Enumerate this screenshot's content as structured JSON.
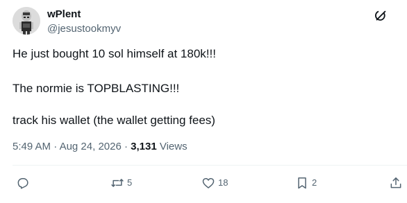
{
  "tweet": {
    "author": {
      "display_name": "wPlent",
      "handle": "@jesustookmyv",
      "avatar_icon": "cartoon-avatar-icon"
    },
    "more_icon": "grok-slash-icon",
    "lines": [
      "He just bought 10 sol himself at 180k!!!",
      "The normie is TOPBLASTING!!!",
      "track his wallet (the wallet getting fees)"
    ],
    "meta": {
      "time": "5:49 AM",
      "separator1": " · ",
      "date": "Aug 24, 2026",
      "separator2": " · ",
      "views_count": "3,131",
      "views_label": " Views"
    },
    "actions": {
      "reply": {
        "icon": "reply-icon",
        "count": ""
      },
      "repost": {
        "icon": "repost-icon",
        "count": "5"
      },
      "like": {
        "icon": "heart-icon",
        "count": "18"
      },
      "bookmark": {
        "icon": "bookmark-icon",
        "count": "2"
      },
      "share": {
        "icon": "share-icon",
        "count": ""
      }
    },
    "colors": {
      "text": "#0f1419",
      "secondary": "#536471",
      "divider": "#eff3f4"
    }
  }
}
